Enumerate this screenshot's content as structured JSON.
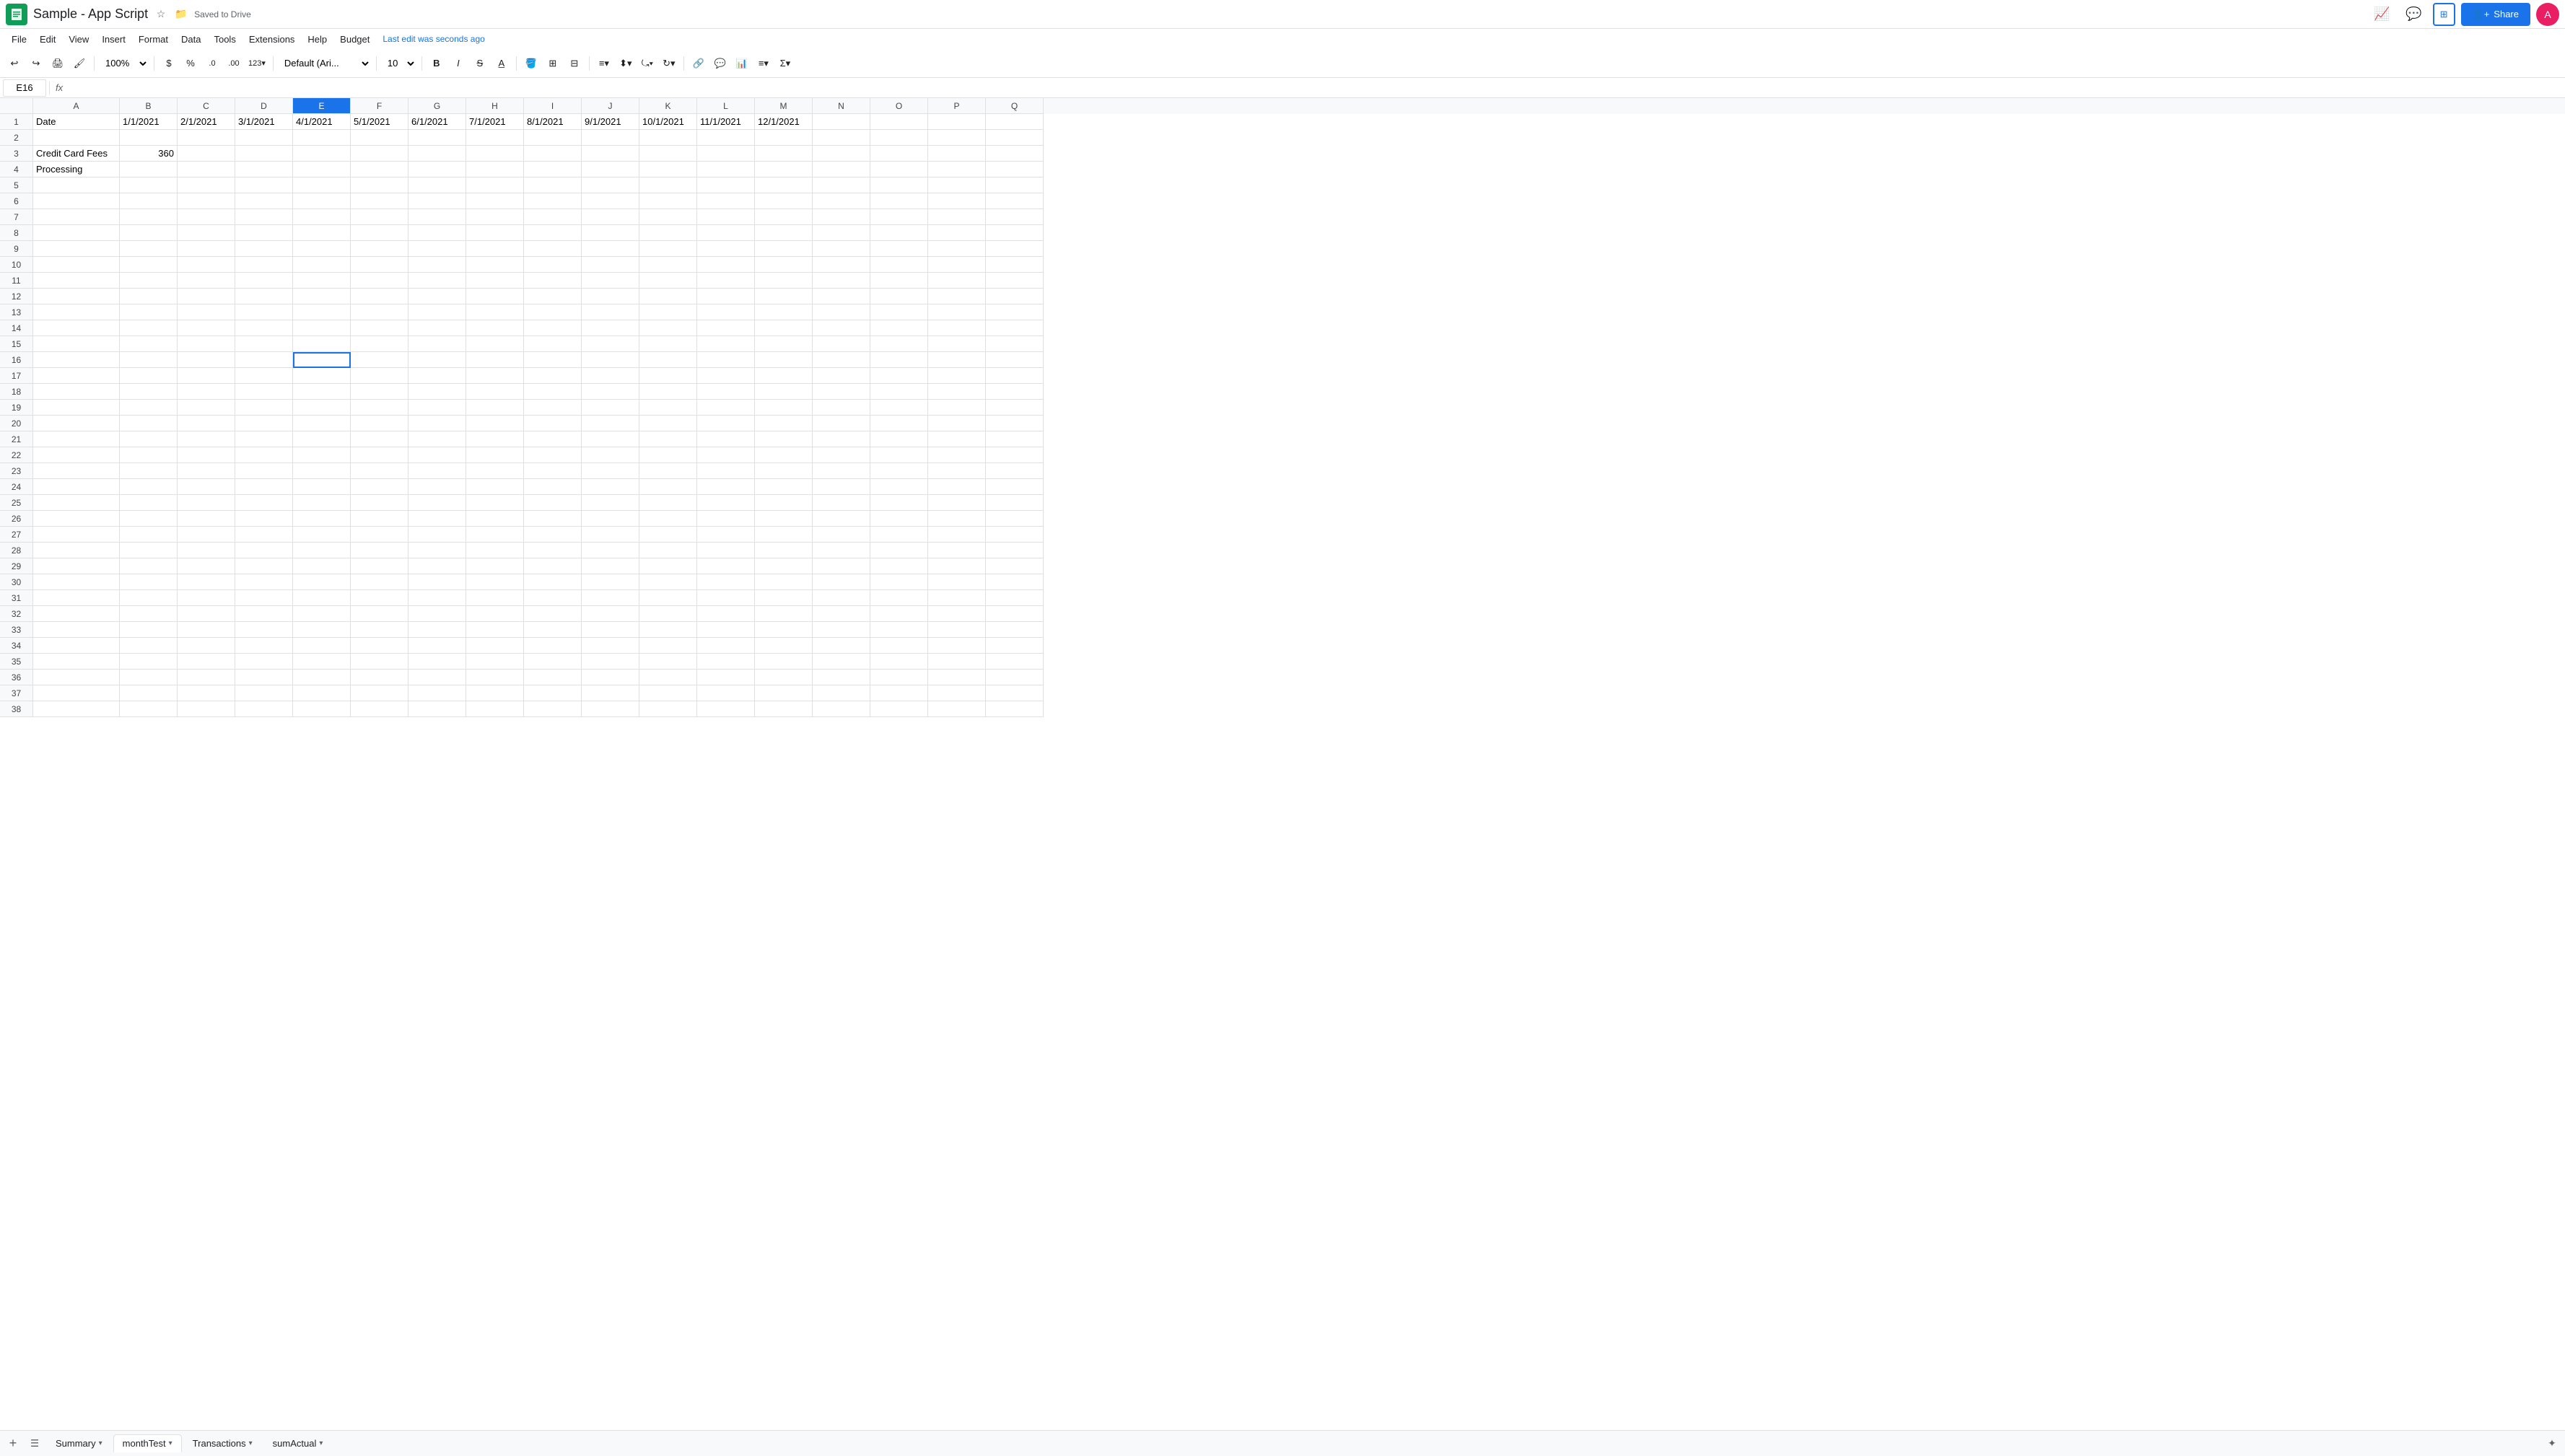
{
  "app": {
    "logo_char": "S",
    "title": "Sample - App Script",
    "save_status": "Saved to Drive",
    "last_edit": "Last edit was seconds ago",
    "avatar_char": "A"
  },
  "menu": {
    "items": [
      "File",
      "Edit",
      "View",
      "Insert",
      "Format",
      "Data",
      "Tools",
      "Extensions",
      "Help",
      "Budget"
    ]
  },
  "toolbar": {
    "zoom": "100%",
    "currency_symbol": "$",
    "percent_symbol": "%",
    "decimal_less": ".0",
    "decimal_more": ".00",
    "more_formats": "123",
    "font_family": "Default (Ari...",
    "font_size": "10",
    "bold": "B",
    "italic": "I",
    "strikethrough": "S",
    "text_color": "A",
    "fill_color": "⬤",
    "borders": "⊞",
    "merge": "⊟",
    "align_h": "≡",
    "align_v": "⬍",
    "wrap": "⤿",
    "rotate": "↻",
    "link": "🔗",
    "comment": "💬",
    "chart": "📊",
    "filter": "≡",
    "functions": "Σ"
  },
  "formula_bar": {
    "cell_ref": "E16",
    "fx_label": "fx"
  },
  "columns": {
    "widths": [
      80,
      80,
      80,
      80,
      80,
      80,
      80,
      80,
      80,
      80,
      80,
      80,
      80,
      80,
      80,
      80,
      80
    ],
    "labels": [
      "A",
      "B",
      "C",
      "D",
      "E",
      "F",
      "G",
      "H",
      "I",
      "J",
      "K",
      "L",
      "M",
      "N",
      "O",
      "P",
      "Q"
    ]
  },
  "rows": {
    "count": 38,
    "data": {
      "1": {
        "A": "Date",
        "B": "1/1/2021",
        "C": "2/1/2021",
        "D": "3/1/2021",
        "E": "4/1/2021",
        "F": "5/1/2021",
        "G": "6/1/2021",
        "H": "7/1/2021",
        "I": "8/1/2021",
        "J": "9/1/2021",
        "K": "10/1/2021",
        "L": "11/1/2021",
        "M": "12/1/2021"
      },
      "3": {
        "A": "Credit Card Fees",
        "B": "360"
      },
      "4": {
        "A": "Processing"
      }
    }
  },
  "selected_cell": {
    "row": 16,
    "col": "E"
  },
  "sheets": [
    {
      "label": "Summary",
      "active": false,
      "has_arrow": true
    },
    {
      "label": "monthTest",
      "active": true,
      "has_arrow": true
    },
    {
      "label": "Transactions",
      "active": false,
      "has_arrow": true
    },
    {
      "label": "sumActual",
      "active": false,
      "has_arrow": true
    }
  ],
  "colors": {
    "selected_border": "#1a73e8",
    "header_bg": "#f8f9fa",
    "grid_line": "#e0e0e0",
    "text_primary": "#202124",
    "text_secondary": "#5f6368",
    "google_green": "#0f9d58",
    "share_blue": "#1a73e8",
    "avatar_pink": "#e91e63"
  }
}
